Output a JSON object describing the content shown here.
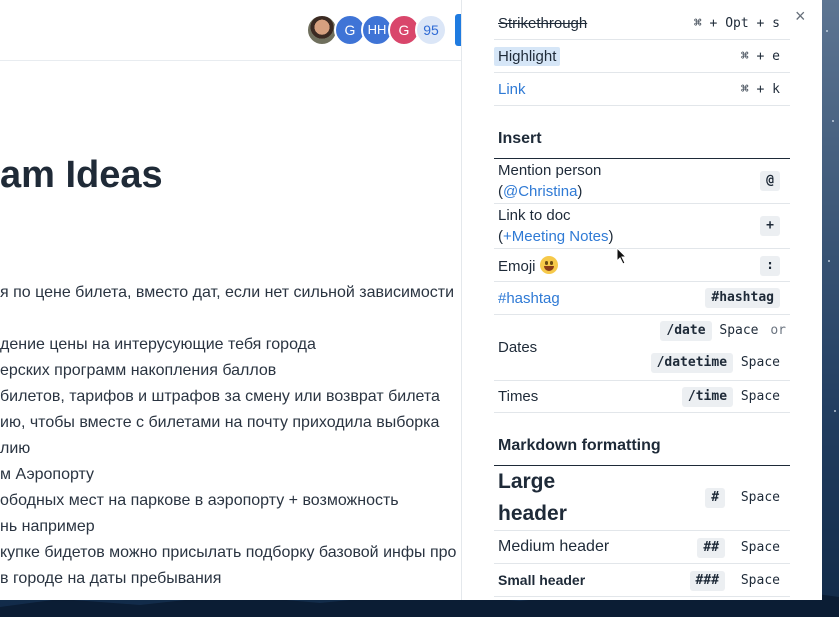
{
  "document": {
    "title": "am Ideas",
    "lines": [
      "я по цене билета, вместо дат, если нет сильной зависимости",
      "",
      "дение цены на интерусующие тебя города",
      "ерских программ накопления баллов",
      "билетов, тарифов и штрафов за смену или возврат билета",
      "ию, чтобы вместе с билетами на почту приходила выборка",
      "лию",
      "м Аэропорту",
      "ободных мест на паркове в аэропорту + возможность",
      "нь например",
      "купке бидетов можно присылать подборку базовой инфы про",
      "в городе на даты пребывания"
    ],
    "avatars": [
      "G",
      "HH",
      "G",
      "95"
    ]
  },
  "panel": {
    "close_label": "×",
    "formatting_rows": [
      {
        "label": "Strikethrough",
        "keys": "⌘ + Opt + s"
      },
      {
        "label": "Highlight",
        "keys": "⌘ + e"
      },
      {
        "label": "Link",
        "keys": "⌘ + k"
      }
    ],
    "insert_heading": "Insert",
    "insert": {
      "mention_label": "Mention person",
      "mention_example": "@Christina",
      "mention_key": "@",
      "linkdoc_label": "Link to doc",
      "linkdoc_example": "+Meeting Notes",
      "linkdoc_key": "+",
      "emoji_label": "Emoji",
      "emoji_key": ":",
      "hashtag_label": "#hashtag",
      "hashtag_key": "#hashtag",
      "dates_label": "Dates",
      "date_code": "/date",
      "datetime_code": "/datetime",
      "space": "Space",
      "or": "or",
      "times_label": "Times",
      "time_code": "/time"
    },
    "markdown_heading": "Markdown formatting",
    "markdown": {
      "large_label_1": "Large",
      "large_label_2": "header",
      "large_key": "#",
      "medium_label": "Medium header",
      "medium_key": "##",
      "small_label": "Small header",
      "small_key": "###",
      "space": "Space"
    }
  },
  "colors": {
    "link": "#2f7ad5",
    "highlight": "#d6e6f7",
    "share_button": "#1f7be0"
  }
}
